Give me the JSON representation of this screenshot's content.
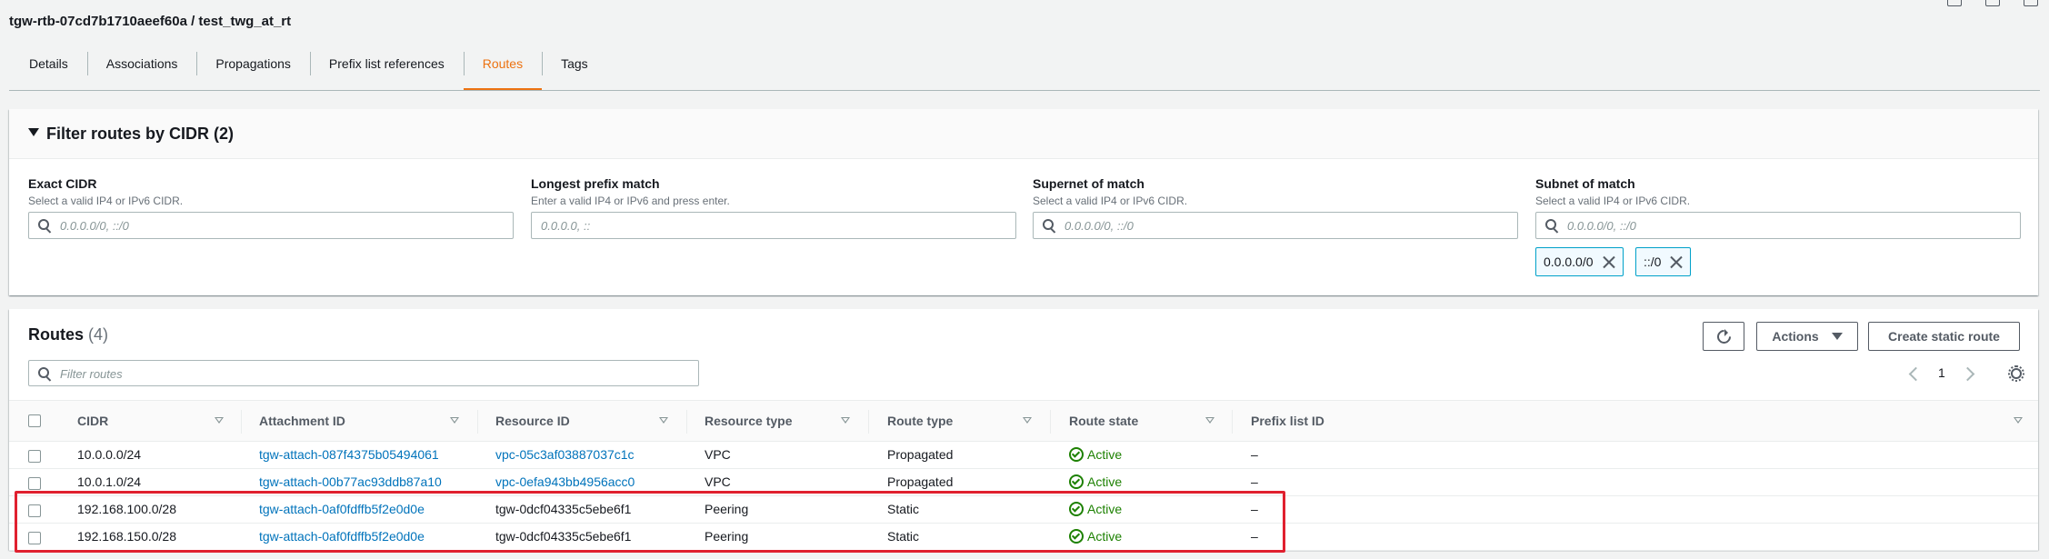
{
  "page": {
    "title": "tgw-rtb-07cd7b1710aeef60a / test_twg_at_rt"
  },
  "tabs": [
    {
      "label": "Details",
      "active": false
    },
    {
      "label": "Associations",
      "active": false
    },
    {
      "label": "Propagations",
      "active": false
    },
    {
      "label": "Prefix list references",
      "active": false
    },
    {
      "label": "Routes",
      "active": true
    },
    {
      "label": "Tags",
      "active": false
    }
  ],
  "filter": {
    "title": "Filter routes by CIDR (2)",
    "groups": [
      {
        "label": "Exact CIDR",
        "description": "Select a valid IP4 or IPv6 CIDR.",
        "placeholder": "0.0.0.0/0, ::/0"
      },
      {
        "label": "Longest prefix match",
        "description": "Enter a valid IP4 or IPv6 and press enter.",
        "placeholder": "0.0.0.0, ::"
      },
      {
        "label": "Supernet of match",
        "description": "Select a valid IP4 or IPv6 CIDR.",
        "placeholder": "0.0.0.0/0, ::/0"
      },
      {
        "label": "Subnet of match",
        "description": "Select a valid IP4 or IPv6 CIDR.",
        "placeholder": "0.0.0.0/0, ::/0"
      }
    ],
    "tokens": [
      "0.0.0.0/0",
      "::/0"
    ]
  },
  "routes": {
    "title": "Routes",
    "count": "(4)",
    "actions_label": "Actions",
    "create_label": "Create static route",
    "search_placeholder": "Filter routes",
    "page_number": "1",
    "columns": [
      "CIDR",
      "Attachment ID",
      "Resource ID",
      "Resource type",
      "Route type",
      "Route state",
      "Prefix list ID"
    ],
    "rows": [
      {
        "cidr": "10.0.0.0/24",
        "attachment": "tgw-attach-087f4375b05494061",
        "resource": "vpc-05c3af03887037c1c",
        "resource_link": true,
        "resource_type": "VPC",
        "route_type": "Propagated",
        "state": "Active",
        "prefix": "–"
      },
      {
        "cidr": "10.0.1.0/24",
        "attachment": "tgw-attach-00b77ac93ddb87a10",
        "resource": "vpc-0efa943bb4956acc0",
        "resource_link": true,
        "resource_type": "VPC",
        "route_type": "Propagated",
        "state": "Active",
        "prefix": "–"
      },
      {
        "cidr": "192.168.100.0/28",
        "attachment": "tgw-attach-0af0fdffb5f2e0d0e",
        "resource": "tgw-0dcf04335c5ebe6f1",
        "resource_link": false,
        "resource_type": "Peering",
        "route_type": "Static",
        "state": "Active",
        "prefix": "–"
      },
      {
        "cidr": "192.168.150.0/28",
        "attachment": "tgw-attach-0af0fdffb5f2e0d0e",
        "resource": "tgw-0dcf04335c5ebe6f1",
        "resource_link": false,
        "resource_type": "Peering",
        "route_type": "Static",
        "state": "Active",
        "prefix": "–"
      }
    ]
  },
  "colors": {
    "accent": "#ec7211",
    "link": "#0073bb",
    "success": "#1d8102",
    "highlight": "#e0202f"
  },
  "icons": [
    "search-icon",
    "close-icon",
    "refresh-icon",
    "caret-down-icon",
    "chevron-left-icon",
    "chevron-right-icon",
    "gear-icon",
    "status-ok-icon"
  ]
}
